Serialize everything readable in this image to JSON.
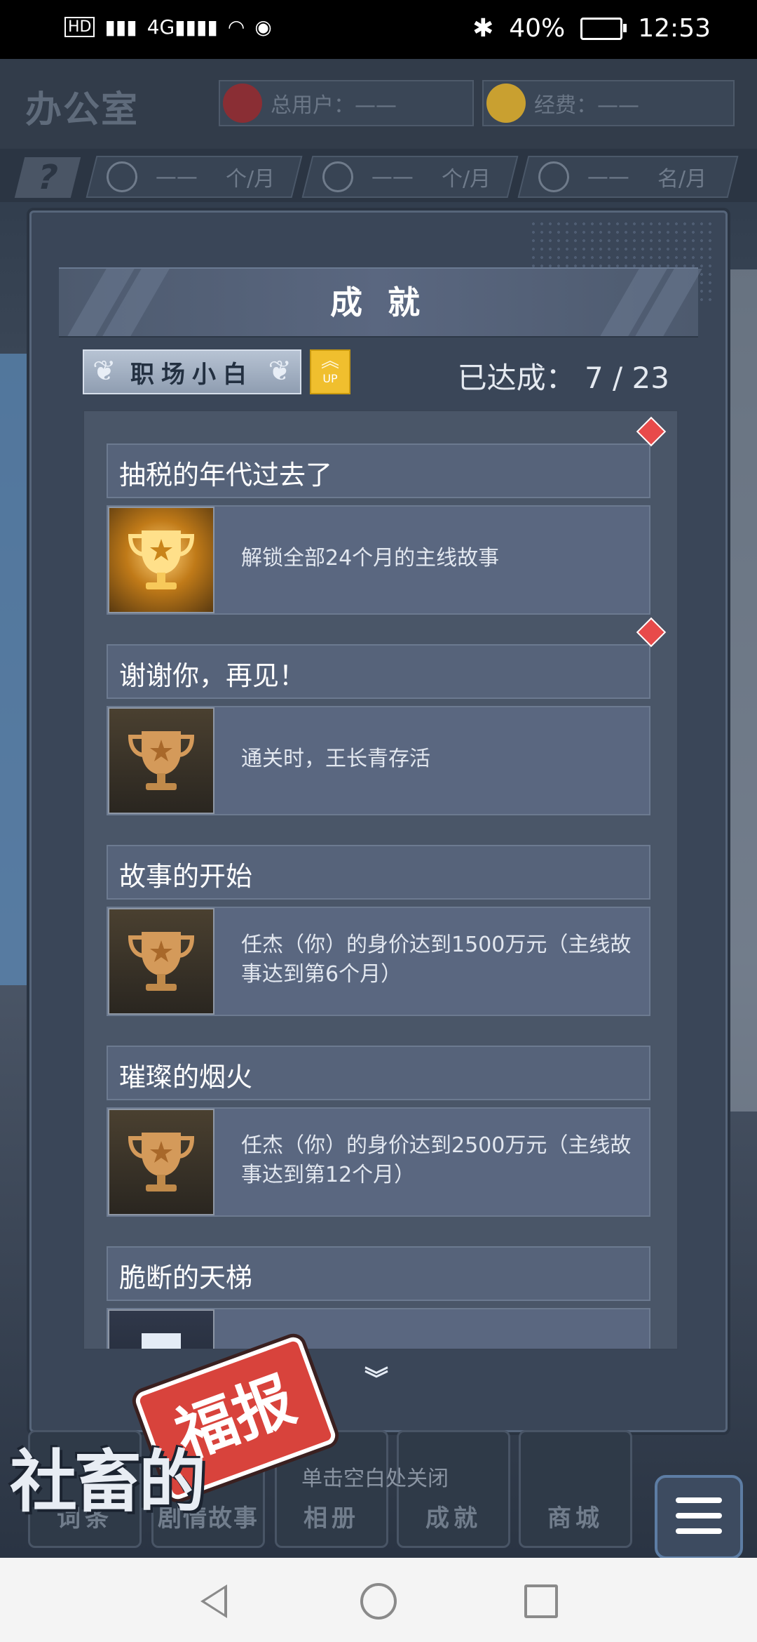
{
  "status_bar": {
    "left_icons": [
      "HD",
      "signal-icon",
      "signal-4g-icon",
      "wifi-icon",
      "eye-icon"
    ],
    "bluetooth": "bluetooth-icon",
    "battery": "40%",
    "time": "12:53"
  },
  "office": {
    "title": "办公室",
    "total_users_label": "总用户：——",
    "funds_label": "经费：——",
    "stats": [
      {
        "icon": "lightbulb-icon",
        "value": "——",
        "unit": "个/月"
      },
      {
        "icon": "wrench-icon",
        "value": "——",
        "unit": "个/月"
      },
      {
        "icon": "person-icon",
        "value": "——",
        "unit": "名/月"
      }
    ],
    "help": "?"
  },
  "panel": {
    "title": "成 就",
    "rank": "职场小白",
    "up": "UP",
    "achieved": "已达成：  7 / 23"
  },
  "achievements": [
    {
      "title": "抽税的年代过去了",
      "desc": "解锁全部24个月的主线故事",
      "trophy": "gold",
      "new": true
    },
    {
      "title": "谢谢你，再见！",
      "desc": "通关时，王长青存活",
      "trophy": "bronze",
      "new": true
    },
    {
      "title": "故事的开始",
      "desc": "任杰（你）的身价达到1500万元（主线故事达到第6个月）",
      "trophy": "bronze",
      "new": false
    },
    {
      "title": "璀璨的烟火",
      "desc": "任杰（你）的身价达到2500万元（主线故事达到第12个月）",
      "trophy": "bronze",
      "new": false
    },
    {
      "title": "脆断的天梯",
      "desc": "",
      "trophy": "silver",
      "new": false
    }
  ],
  "bottom_menu": [
    {
      "label": "词条"
    },
    {
      "label": "剧情故事"
    },
    {
      "label": "相册"
    },
    {
      "label": "成就"
    },
    {
      "label": "商城"
    }
  ],
  "close_hint": "单击空白处关闭",
  "logo": {
    "main": "社畜的",
    "badge": "福报"
  }
}
